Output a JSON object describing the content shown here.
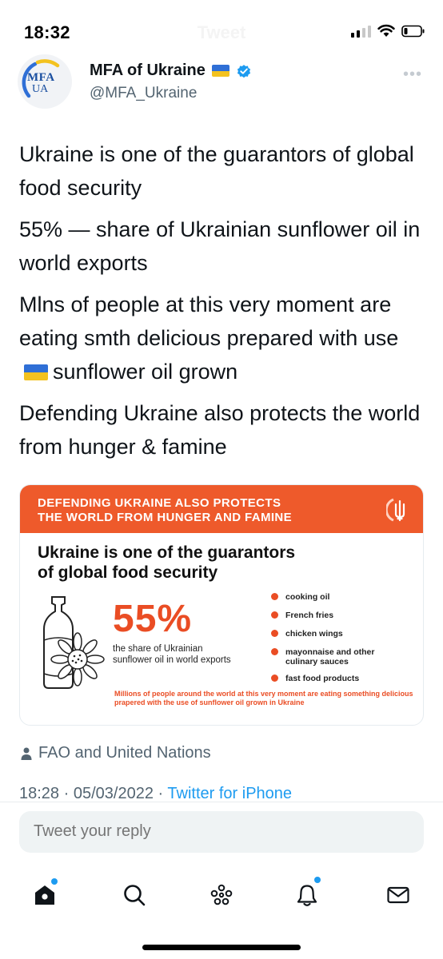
{
  "status_bar": {
    "time": "18:32",
    "nav_title": "Tweet"
  },
  "author": {
    "name": "MFA of Ukraine",
    "handle": "@MFA_Ukraine",
    "avatar_text_top": "MFA",
    "avatar_text_bottom": "UA",
    "flag_icon": "ukraine-flag",
    "verified_icon": "verified-badge-icon",
    "more_icon": "more-dots-icon"
  },
  "tweet": {
    "paragraph_1": "Ukraine is one of the guarantors of global food security",
    "paragraph_2": "55% — share of Ukrainian sunflower oil in world exports",
    "paragraph_3_before_flag": "Mlns of people at this very moment are eating smth delicious prepared with use",
    "paragraph_3_after_flag": "sunflower oil grown",
    "paragraph_4": "Defending Ukraine also protects the world from hunger & famine"
  },
  "infographic": {
    "banner_line_1": "DEFENDING UKRAINE ALSO PROTECTS",
    "banner_line_2": "THE WORLD FROM HUNGER AND FAMINE",
    "heading_line_1": "Ukraine is one of the guarantors",
    "heading_line_2": "of global food security",
    "percent": "55%",
    "percent_description": "the share of Ukrainian sunflower oil in world exports",
    "uses": [
      "cooking oil",
      "French fries",
      "chicken wings",
      "mayonnaise and other culinary sauces",
      "fast food products"
    ],
    "footer": "Millions of people around the world at this very moment are eating something delicious prapered with the use of sunflower oil grown in Ukraine",
    "colors": {
      "accent": "#ea4d24",
      "banner": "#ee5a2b"
    }
  },
  "source": {
    "icon": "person-icon",
    "text": "FAO and United Nations"
  },
  "meta": {
    "time": "18:28",
    "separator": "·",
    "date": "05/03/2022",
    "client": "Twitter for iPhone"
  },
  "reply": {
    "placeholder": "Tweet your reply"
  },
  "tabbar": {
    "items": [
      "home-icon",
      "search-icon",
      "spaces-icon",
      "notifications-icon",
      "messages-icon"
    ]
  },
  "colors": {
    "primary_text": "#0f1419",
    "secondary_text": "#536471",
    "link": "#1d9bf0"
  }
}
